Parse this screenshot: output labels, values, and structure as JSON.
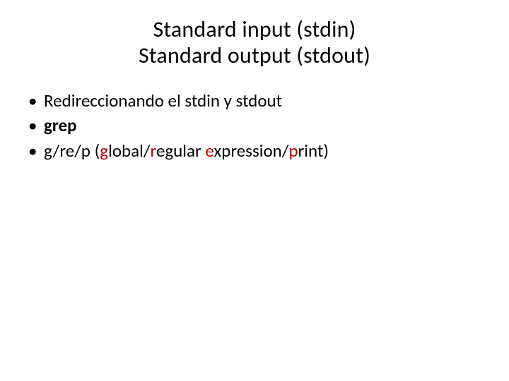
{
  "title": {
    "line1": "Standard input (stdin)",
    "line2": "Standard output (stdout)"
  },
  "bullets": {
    "b1": "Redireccionando el stdin y stdout",
    "b2": "grep",
    "b3": {
      "t1": "g/re/p (",
      "g": "g",
      "t2": "lobal/",
      "r": "r",
      "t3": "egular ",
      "e": "e",
      "t4": "xpression/",
      "p": "p",
      "t5": "rint)"
    }
  }
}
